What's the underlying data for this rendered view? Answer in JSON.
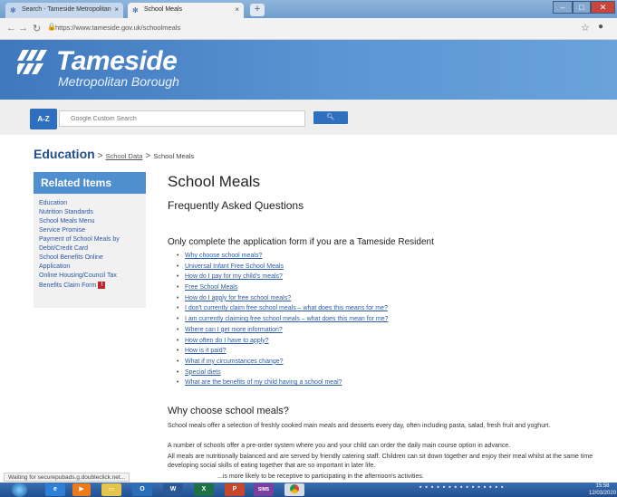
{
  "browser": {
    "tabs": [
      {
        "title": "Search - Tameside Metropolitan"
      },
      {
        "title": "School Meals"
      }
    ],
    "url": "https://www.tameside.gov.uk/schoolmeals",
    "status": "Waiting for securepubads.g.doubleclick.net..."
  },
  "header": {
    "logo_title": "Tameside",
    "logo_subtitle": "Metropolitan Borough"
  },
  "search": {
    "az_label": "A-Z",
    "placeholder": "Google Custom Search"
  },
  "breadcrumb": {
    "section": "Education",
    "level1": "School Data",
    "current": "School Meals"
  },
  "sidebar": {
    "heading": "Related Items",
    "items": [
      "Education",
      "Nutrition Standards",
      "School Meals Menu",
      "Service Promise",
      "Payment of School Meals by",
      "Debit/Credit Card",
      "School Benefits Online",
      "Application",
      "Online Housing/Council Tax",
      "Benefits Claim Form"
    ]
  },
  "main": {
    "title": "School Meals",
    "subtitle": "Frequently Asked Questions",
    "resident_note": "Only complete the application form if you are a Tameside Resident",
    "faq_links": [
      "Why choose school meals?",
      "Universal Infant Free School Meals",
      "How do I pay for my child's meals?",
      "Free School Meals",
      "How do I apply for free school meals?",
      "I don't currently claim free school meals – what does this means for me?",
      "I am currently claiming free school meals – what does this mean for me?",
      "Where can I get more information?",
      "How often do I have to apply?",
      "How is it paid?",
      "What if my circumstances change?",
      "Special diets",
      "What are the benefits of my child having a school meal?"
    ],
    "why_heading": "Why choose school meals?",
    "paragraphs": [
      "School meals offer a selection of freshly cooked main meals and desserts every day, often including pasta, salad, fresh fruit and yoghurt.",
      "A number of schools offer a pre-order system where you and your child can order the daily main course option in advance.",
      "All meals are nutritionally balanced and are served by friendly catering staff. Children can sit down together and enjoy their meal whilst at the same time developing social skills of eating together that are so important in later life.",
      "...is more likely to be receptive to participating in the afternoon's activities."
    ]
  },
  "taskbar": {
    "apps": [
      "",
      "",
      "",
      "",
      "",
      "",
      "",
      "SIMS",
      ""
    ],
    "time": "15:58",
    "date": "12/03/2020"
  }
}
